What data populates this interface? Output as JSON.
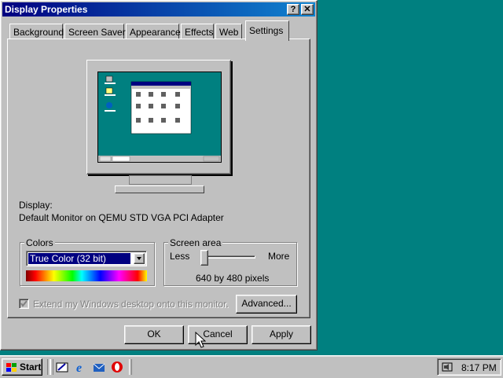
{
  "window": {
    "title": "Display Properties",
    "help_button": "?",
    "close_button": "✕"
  },
  "tabs": [
    {
      "label": "Background"
    },
    {
      "label": "Screen Saver"
    },
    {
      "label": "Appearance"
    },
    {
      "label": "Effects"
    },
    {
      "label": "Web"
    },
    {
      "label": "Settings",
      "active": true
    }
  ],
  "settings": {
    "display_label": "Display:",
    "display_value": "Default Monitor on QEMU STD VGA PCI Adapter",
    "colors": {
      "group_label": "Colors",
      "selected": "True Color (32 bit)"
    },
    "screen_area": {
      "group_label": "Screen area",
      "less": "Less",
      "more": "More",
      "value_text": "640 by 480 pixels"
    },
    "extend_checkbox": {
      "label": "Extend my Windows desktop onto this monitor.",
      "checked": true,
      "disabled": true
    },
    "advanced_button": "Advanced..."
  },
  "buttons": {
    "ok": "OK",
    "cancel": "Cancel",
    "apply": "Apply"
  },
  "taskbar": {
    "start_label": "Start",
    "quick_launch_icons": [
      "show-desktop-icon",
      "internet-explorer-icon",
      "outlook-express-icon",
      "opera-icon"
    ],
    "tray_icon": "volume-icon",
    "clock": "8:17 PM"
  },
  "colors": {
    "desktop": "#008080",
    "title_bar": "#000080",
    "face": "#c0c0c0"
  }
}
